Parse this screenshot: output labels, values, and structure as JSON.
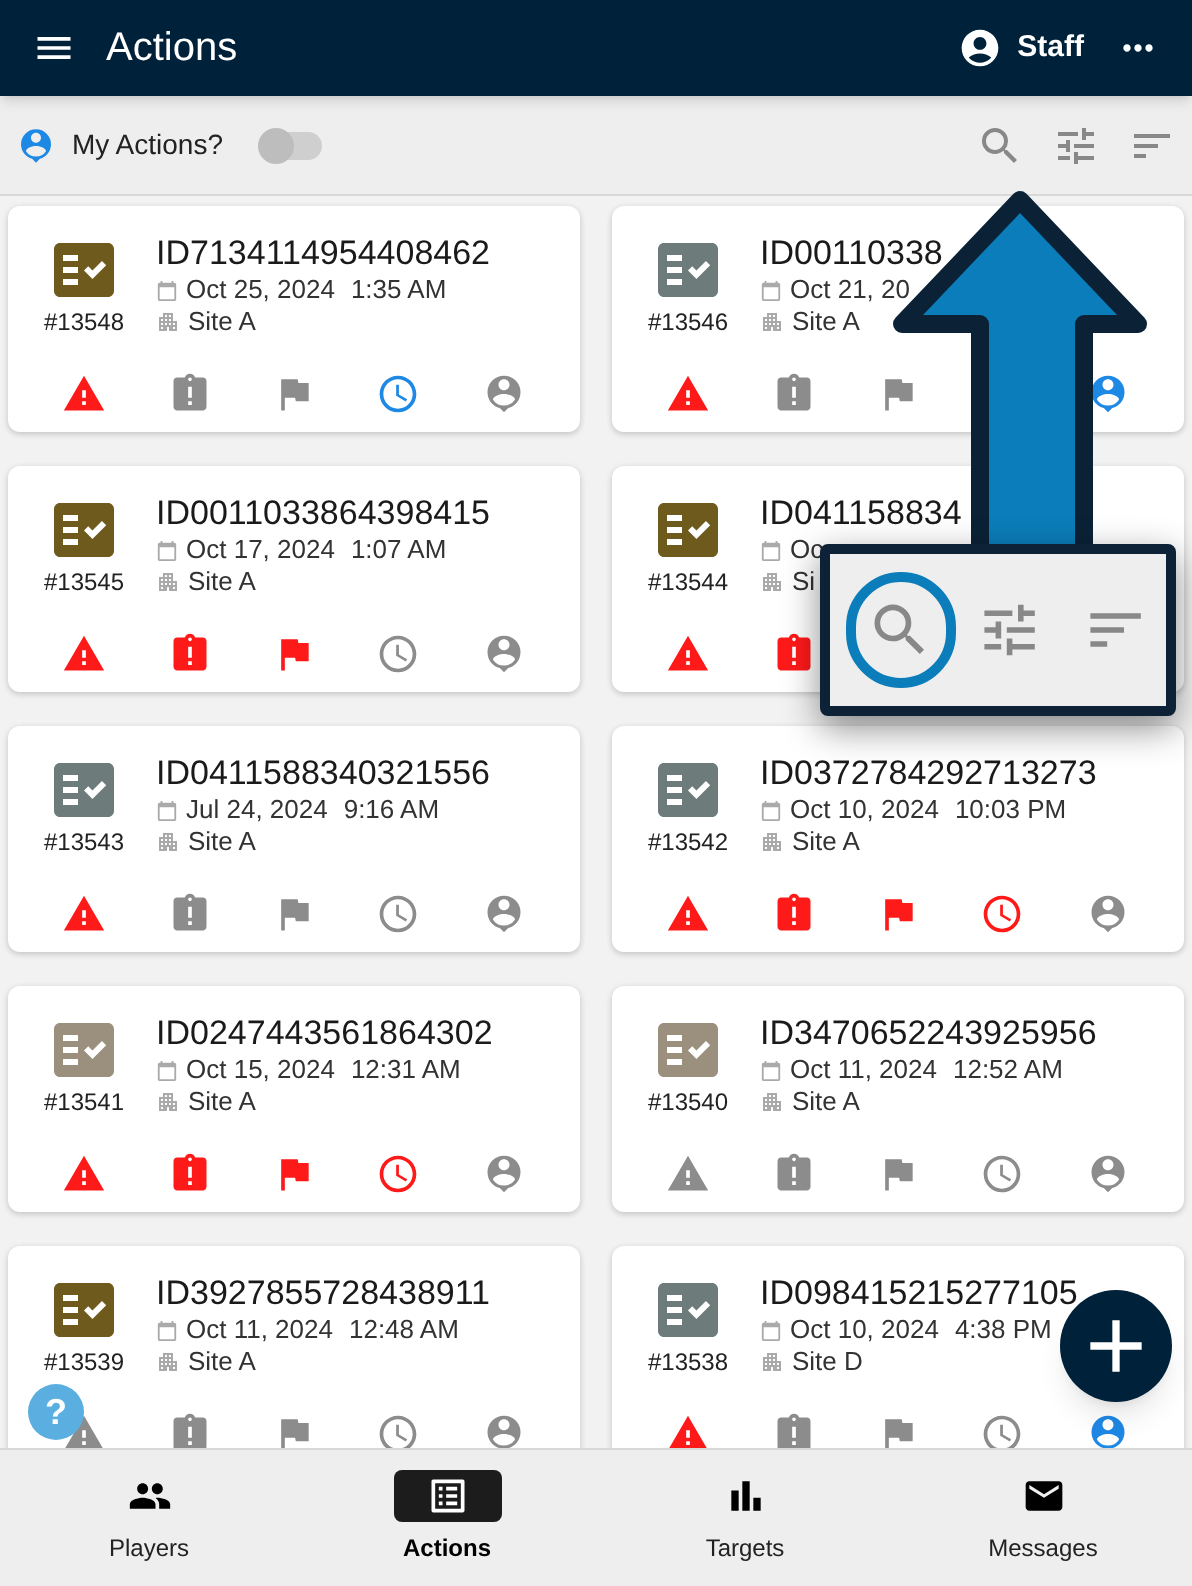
{
  "header": {
    "title": "Actions",
    "user": "Staff"
  },
  "toolbar": {
    "label": "My Actions?",
    "on": false
  },
  "cards": [
    {
      "title": "ID7134114954408462",
      "date": "Oct 25, 2024",
      "time": "1:35 AM",
      "site": "Site A",
      "number": "#13548",
      "color": "#6e5a1c",
      "icons": [
        {
          "kind": "warning",
          "color": "#ff1a1a"
        },
        {
          "kind": "clipboard",
          "color": "#8c8c8c"
        },
        {
          "kind": "flag",
          "color": "#8c8c8c"
        },
        {
          "kind": "clock",
          "color": "#1e88e5"
        },
        {
          "kind": "person",
          "color": "#8c8c8c"
        }
      ]
    },
    {
      "title": "ID00110338",
      "date": "Oct 21, 20",
      "site": "Site A",
      "number": "#13546",
      "color": "#6d7b7a",
      "icons": [
        {
          "kind": "warning",
          "color": "#ff1a1a"
        },
        {
          "kind": "clipboard",
          "color": "#8c8c8c"
        },
        {
          "kind": "flag",
          "color": "#8c8c8c"
        },
        {
          "kind": "person",
          "color": "#1e88e5"
        }
      ]
    },
    {
      "title": "ID0011033864398415",
      "date": "Oct 17, 2024",
      "time": "1:07 AM",
      "site": "Site A",
      "number": "#13545",
      "color": "#6e5a1c",
      "icons": [
        {
          "kind": "warning",
          "color": "#ff1a1a"
        },
        {
          "kind": "clipboard",
          "color": "#ff1a1a"
        },
        {
          "kind": "flag",
          "color": "#ff1a1a"
        },
        {
          "kind": "clock",
          "color": "#8c8c8c"
        },
        {
          "kind": "person",
          "color": "#8c8c8c"
        }
      ]
    },
    {
      "title": "ID041158834",
      "date": "Oc",
      "site": "Si",
      "number": "#13544",
      "color": "#6e5a1c",
      "icons": [
        {
          "kind": "warning",
          "color": "#ff1a1a"
        },
        {
          "kind": "clipboard",
          "color": "#ff1a1a"
        }
      ]
    },
    {
      "title": "ID0411588340321556",
      "date": "Jul 24, 2024",
      "time": "9:16 AM",
      "site": "Site A",
      "number": "#13543",
      "color": "#6d7b7a",
      "icons": [
        {
          "kind": "warning",
          "color": "#ff1a1a"
        },
        {
          "kind": "clipboard",
          "color": "#8c8c8c"
        },
        {
          "kind": "flag",
          "color": "#8c8c8c"
        },
        {
          "kind": "clock",
          "color": "#8c8c8c"
        },
        {
          "kind": "person",
          "color": "#8c8c8c"
        }
      ]
    },
    {
      "title": "ID0372784292713273",
      "date": "Oct 10, 2024",
      "time": "10:03 PM",
      "site": "Site A",
      "number": "#13542",
      "color": "#6d7b7a",
      "icons": [
        {
          "kind": "warning",
          "color": "#ff1a1a"
        },
        {
          "kind": "clipboard",
          "color": "#ff1a1a"
        },
        {
          "kind": "flag",
          "color": "#ff1a1a"
        },
        {
          "kind": "clock",
          "color": "#ff1a1a"
        },
        {
          "kind": "person",
          "color": "#8c8c8c"
        }
      ]
    },
    {
      "title": "ID0247443561864302",
      "date": "Oct 15, 2024",
      "time": "12:31 AM",
      "site": "Site A",
      "number": "#13541",
      "color": "#9b907d",
      "icons": [
        {
          "kind": "warning",
          "color": "#ff1a1a"
        },
        {
          "kind": "clipboard",
          "color": "#ff1a1a"
        },
        {
          "kind": "flag",
          "color": "#ff1a1a"
        },
        {
          "kind": "clock",
          "color": "#ff1a1a"
        },
        {
          "kind": "person",
          "color": "#8c8c8c"
        }
      ]
    },
    {
      "title": "ID3470652243925956",
      "date": "Oct 11, 2024",
      "time": "12:52 AM",
      "site": "Site A",
      "number": "#13540",
      "color": "#9b907d",
      "icons": [
        {
          "kind": "warning",
          "color": "#8c8c8c"
        },
        {
          "kind": "clipboard",
          "color": "#8c8c8c"
        },
        {
          "kind": "flag",
          "color": "#8c8c8c"
        },
        {
          "kind": "clock",
          "color": "#8c8c8c"
        },
        {
          "kind": "person",
          "color": "#8c8c8c"
        }
      ]
    },
    {
      "title": "ID3927855728438911",
      "date": "Oct 11, 2024",
      "time": "12:48 AM",
      "site": "Site A",
      "number": "#13539",
      "color": "#6e5a1c",
      "icons": [
        {
          "kind": "warning",
          "color": "#8c8c8c"
        },
        {
          "kind": "clipboard",
          "color": "#8c8c8c"
        },
        {
          "kind": "flag",
          "color": "#8c8c8c"
        },
        {
          "kind": "clock",
          "color": "#8c8c8c"
        },
        {
          "kind": "person",
          "color": "#8c8c8c"
        }
      ]
    },
    {
      "title": "ID098415215277105",
      "date": "Oct 10, 2024",
      "time": "4:38 PM",
      "site": "Site D",
      "number": "#13538",
      "color": "#6d7b7a",
      "icons": [
        {
          "kind": "warning",
          "color": "#ff1a1a"
        },
        {
          "kind": "clipboard",
          "color": "#8c8c8c"
        },
        {
          "kind": "flag",
          "color": "#8c8c8c"
        },
        {
          "kind": "clock",
          "color": "#8c8c8c"
        },
        {
          "kind": "person",
          "color": "#1e88e5"
        }
      ]
    }
  ],
  "help": {
    "label": "?"
  },
  "nav": [
    {
      "kind": "players",
      "label": "Players",
      "selected": false
    },
    {
      "kind": "actions",
      "label": "Actions",
      "selected": true
    },
    {
      "kind": "targets",
      "label": "Targets",
      "selected": false
    },
    {
      "kind": "messages",
      "label": "Messages",
      "selected": false
    }
  ]
}
